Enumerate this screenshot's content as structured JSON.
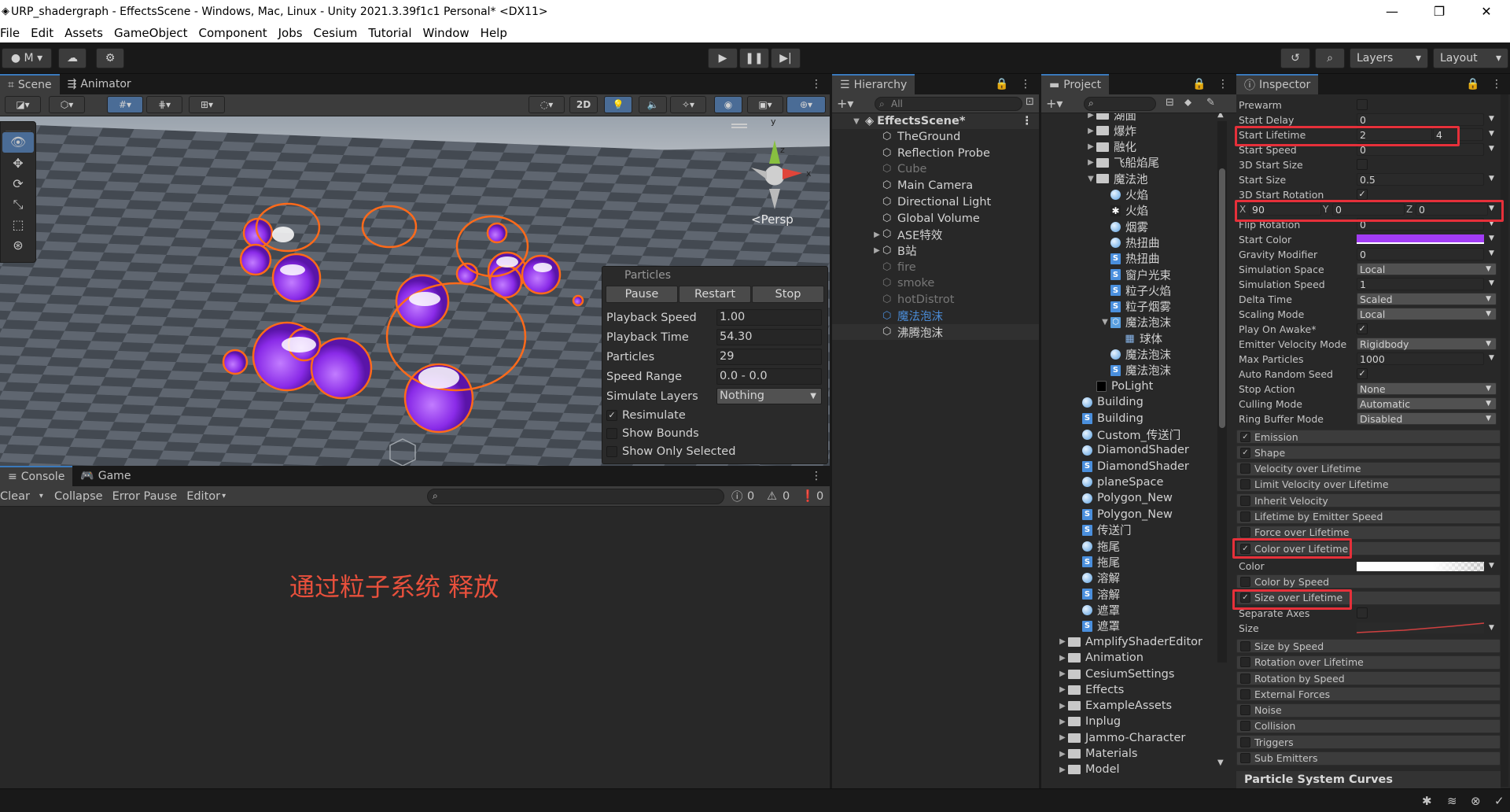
{
  "window": {
    "title": "URP_shadergraph - EffectsScene - Windows, Mac, Linux - Unity 2021.3.39f1c1 Personal* <DX11>"
  },
  "menu": [
    "File",
    "Edit",
    "Assets",
    "GameObject",
    "Component",
    "Jobs",
    "Cesium",
    "Tutorial",
    "Window",
    "Help"
  ],
  "toolbar": {
    "account": "M",
    "layers": "Layers",
    "layout": "Layout"
  },
  "scene_tabs": {
    "scene": "Scene",
    "animator": "Animator"
  },
  "scene": {
    "btn_2d": "2D",
    "persp": "<Persp",
    "gizmo_x": "x",
    "gizmo_y": "y",
    "gizmo_z": "z"
  },
  "particles_overlay": {
    "title": "Particles",
    "buttons": [
      "Pause",
      "Restart",
      "Stop"
    ],
    "rows": [
      {
        "label": "Playback Speed",
        "value": "1.00"
      },
      {
        "label": "Playback Time",
        "value": "54.30"
      },
      {
        "label": "Particles",
        "value": "29"
      },
      {
        "label": "Speed Range",
        "value": "0.0 - 0.0"
      },
      {
        "label": "Simulate Layers",
        "value": "Nothing"
      }
    ],
    "checks": [
      {
        "label": "Resimulate",
        "checked": true
      },
      {
        "label": "Show Bounds",
        "checked": false
      },
      {
        "label": "Show Only Selected",
        "checked": false
      }
    ]
  },
  "console": {
    "tab_console": "Console",
    "tab_game": "Game",
    "clear": "Clear",
    "collapse": "Collapse",
    "error_pause": "Error Pause",
    "editor": "Editor",
    "count_info": "0",
    "count_warn": "0",
    "count_error": "0",
    "annotation": "通过粒子系统 释放"
  },
  "hierarchy": {
    "tab": "Hierarchy",
    "search": "All",
    "scene": "EffectsScene*",
    "items": [
      {
        "label": "TheGround",
        "state": "normal",
        "expand": false
      },
      {
        "label": "Reflection Probe",
        "state": "normal",
        "expand": false
      },
      {
        "label": "Cube",
        "state": "dim",
        "expand": false
      },
      {
        "label": "Main Camera",
        "state": "normal",
        "expand": false
      },
      {
        "label": "Directional Light",
        "state": "normal",
        "expand": false
      },
      {
        "label": "Global Volume",
        "state": "normal",
        "expand": false
      },
      {
        "label": "ASE特效",
        "state": "normal",
        "expand": true
      },
      {
        "label": "B站",
        "state": "normal",
        "expand": true
      },
      {
        "label": "fire",
        "state": "dim",
        "expand": false
      },
      {
        "label": "smoke",
        "state": "dim",
        "expand": false
      },
      {
        "label": "hotDistrot",
        "state": "dim",
        "expand": false
      },
      {
        "label": "魔法泡沫",
        "state": "sel",
        "expand": false
      },
      {
        "label": "沸腾泡沫",
        "state": "normal",
        "expand": false
      }
    ]
  },
  "project": {
    "tab": "Project",
    "items": [
      {
        "label": "湖面",
        "type": "folder",
        "indent": 2,
        "arrow": "right"
      },
      {
        "label": "爆炸",
        "type": "folder",
        "indent": 2,
        "arrow": "right"
      },
      {
        "label": "融化",
        "type": "folder",
        "indent": 2,
        "arrow": "right"
      },
      {
        "label": "飞船焰尾",
        "type": "folder",
        "indent": 2,
        "arrow": "right"
      },
      {
        "label": "魔法池",
        "type": "folder",
        "indent": 2,
        "arrow": "down"
      },
      {
        "label": "火焰",
        "type": "mat",
        "indent": 3,
        "arrow": ""
      },
      {
        "label": "火焰",
        "type": "vfx",
        "indent": 3,
        "arrow": ""
      },
      {
        "label": "烟雾",
        "type": "mat",
        "indent": 3,
        "arrow": ""
      },
      {
        "label": "热扭曲",
        "type": "mat",
        "indent": 3,
        "arrow": ""
      },
      {
        "label": "热扭曲",
        "type": "shader",
        "indent": 3,
        "arrow": ""
      },
      {
        "label": "窗户光束",
        "type": "shader",
        "indent": 3,
        "arrow": ""
      },
      {
        "label": "粒子火焰",
        "type": "shader",
        "indent": 3,
        "arrow": ""
      },
      {
        "label": "粒子烟雾",
        "type": "shader",
        "indent": 3,
        "arrow": ""
      },
      {
        "label": "魔法泡沫",
        "type": "prefab",
        "indent": 3,
        "arrow": "down"
      },
      {
        "label": "球体",
        "type": "mesh",
        "indent": 4,
        "arrow": ""
      },
      {
        "label": "魔法泡沫",
        "type": "mat",
        "indent": 3,
        "arrow": ""
      },
      {
        "label": "魔法泡沫",
        "type": "shader",
        "indent": 3,
        "arrow": ""
      },
      {
        "label": "PoLight",
        "type": "black",
        "indent": 2,
        "arrow": ""
      },
      {
        "label": "Building",
        "type": "mat",
        "indent": 1,
        "arrow": ""
      },
      {
        "label": "Building",
        "type": "shader",
        "indent": 1,
        "arrow": ""
      },
      {
        "label": "Custom_传送门",
        "type": "mat",
        "indent": 1,
        "arrow": ""
      },
      {
        "label": "DiamondShader",
        "type": "mat",
        "indent": 1,
        "arrow": ""
      },
      {
        "label": "DiamondShader",
        "type": "shader",
        "indent": 1,
        "arrow": ""
      },
      {
        "label": "planeSpace",
        "type": "mat",
        "indent": 1,
        "arrow": ""
      },
      {
        "label": "Polygon_New",
        "type": "mat",
        "indent": 1,
        "arrow": ""
      },
      {
        "label": "Polygon_New",
        "type": "shader",
        "indent": 1,
        "arrow": ""
      },
      {
        "label": "传送门",
        "type": "shader",
        "indent": 1,
        "arrow": ""
      },
      {
        "label": "拖尾",
        "type": "mat",
        "indent": 1,
        "arrow": ""
      },
      {
        "label": "拖尾",
        "type": "shader",
        "indent": 1,
        "arrow": ""
      },
      {
        "label": "溶解",
        "type": "mat",
        "indent": 1,
        "arrow": ""
      },
      {
        "label": "溶解",
        "type": "shader",
        "indent": 1,
        "arrow": ""
      },
      {
        "label": "遮罩",
        "type": "mat",
        "indent": 1,
        "arrow": ""
      },
      {
        "label": "遮罩",
        "type": "shader",
        "indent": 1,
        "arrow": ""
      },
      {
        "label": "AmplifyShaderEditor",
        "type": "folder",
        "indent": 0,
        "arrow": "right"
      },
      {
        "label": "Animation",
        "type": "folder",
        "indent": 0,
        "arrow": "right"
      },
      {
        "label": "CesiumSettings",
        "type": "folder",
        "indent": 0,
        "arrow": "right"
      },
      {
        "label": "Effects",
        "type": "folder",
        "indent": 0,
        "arrow": "right"
      },
      {
        "label": "ExampleAssets",
        "type": "folder",
        "indent": 0,
        "arrow": "right"
      },
      {
        "label": "Inplug",
        "type": "folder",
        "indent": 0,
        "arrow": "right"
      },
      {
        "label": "Jammo-Character",
        "type": "folder",
        "indent": 0,
        "arrow": "right"
      },
      {
        "label": "Materials",
        "type": "folder",
        "indent": 0,
        "arrow": "right"
      },
      {
        "label": "Model",
        "type": "folder",
        "indent": 0,
        "arrow": "right"
      }
    ]
  },
  "inspector": {
    "tab": "Inspector",
    "rows": [
      {
        "label": "Prewarm",
        "kind": "check",
        "value": ""
      },
      {
        "label": "Start Delay",
        "kind": "field",
        "value": "0"
      },
      {
        "label": "Start Lifetime",
        "kind": "range",
        "value": "2",
        "value2": "4"
      },
      {
        "label": "Start Speed",
        "kind": "field",
        "value": "0"
      },
      {
        "label": "3D Start Size",
        "kind": "check",
        "value": ""
      },
      {
        "label": "Start Size",
        "kind": "field",
        "value": "0.5"
      },
      {
        "label": "3D Start Rotation",
        "kind": "check",
        "value": "✓"
      },
      {
        "label": "",
        "kind": "xyz",
        "x": "90",
        "y": "0",
        "z": "0"
      },
      {
        "label": "Flip Rotation",
        "kind": "field",
        "value": "0"
      },
      {
        "label": "Start Color",
        "kind": "color",
        "value": ""
      },
      {
        "label": "Gravity Modifier",
        "kind": "field",
        "value": "0"
      },
      {
        "label": "Simulation Space",
        "kind": "dropdown",
        "value": "Local"
      },
      {
        "label": "Simulation Speed",
        "kind": "field",
        "value": "1"
      },
      {
        "label": "Delta Time",
        "kind": "dropdown",
        "value": "Scaled"
      },
      {
        "label": "Scaling Mode",
        "kind": "dropdown",
        "value": "Local"
      },
      {
        "label": "Play On Awake*",
        "kind": "check",
        "value": "✓"
      },
      {
        "label": "Emitter Velocity Mode",
        "kind": "dropdown",
        "value": "Rigidbody"
      },
      {
        "label": "Max Particles",
        "kind": "field",
        "value": "1000"
      },
      {
        "label": "Auto Random Seed",
        "kind": "check",
        "value": "✓"
      },
      {
        "label": "Stop Action",
        "kind": "dropdown",
        "value": "None"
      },
      {
        "label": "Culling Mode",
        "kind": "dropdown",
        "value": "Automatic"
      },
      {
        "label": "Ring Buffer Mode",
        "kind": "dropdown",
        "value": "Disabled"
      }
    ],
    "xyz_labels": {
      "x": "X",
      "y": "Y",
      "z": "Z"
    },
    "modules": [
      {
        "label": "Emission",
        "checked": true
      },
      {
        "label": "Shape",
        "checked": true
      },
      {
        "label": "Velocity over Lifetime",
        "checked": false
      },
      {
        "label": "Limit Velocity over Lifetime",
        "checked": false
      },
      {
        "label": "Inherit Velocity",
        "checked": false
      },
      {
        "label": "Lifetime by Emitter Speed",
        "checked": false
      },
      {
        "label": "Force over Lifetime",
        "checked": false
      },
      {
        "label": "Color over Lifetime",
        "checked": true
      }
    ],
    "color_label": "Color",
    "modules2": [
      {
        "label": "Color by Speed",
        "checked": false
      },
      {
        "label": "Size over Lifetime",
        "checked": true
      }
    ],
    "separate_axes": "Separate Axes",
    "size_label": "Size",
    "modules3": [
      {
        "label": "Size by Speed",
        "checked": false
      },
      {
        "label": "Rotation over Lifetime",
        "checked": false
      },
      {
        "label": "Rotation by Speed",
        "checked": false
      },
      {
        "label": "External Forces",
        "checked": false
      },
      {
        "label": "Noise",
        "checked": false
      },
      {
        "label": "Collision",
        "checked": false
      },
      {
        "label": "Triggers",
        "checked": false
      },
      {
        "label": "Sub Emitters",
        "checked": false
      }
    ],
    "footer": "Particle System Curves"
  },
  "colors": {
    "accent": "#3a79bb",
    "highlight": "#e6303a",
    "particle": "#9b3cf0",
    "annotation": "#e8503c",
    "start_color": "#a23cf5"
  }
}
